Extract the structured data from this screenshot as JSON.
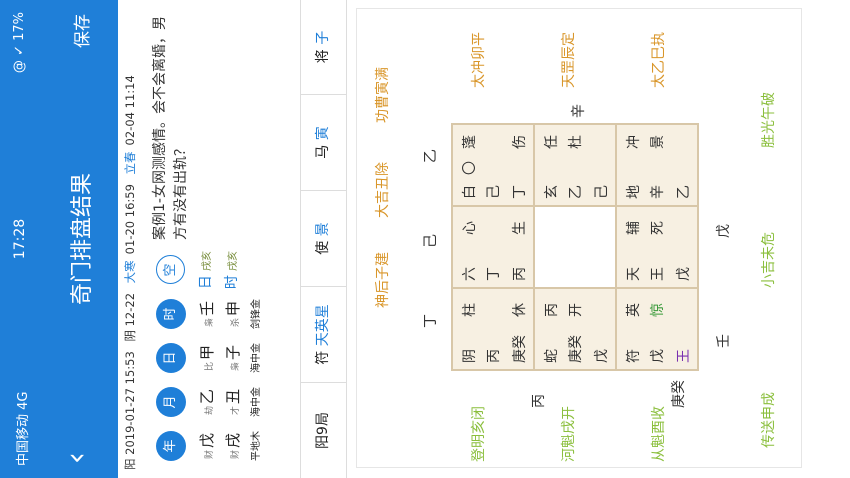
{
  "status": {
    "carrier": "中国移动 4G",
    "time": "17:28",
    "battery": "@ ✓ 17%"
  },
  "header": {
    "title": "奇门排盘结果",
    "save": "保存"
  },
  "dates": {
    "solar": "阳 2019-01-27 15:53",
    "lunar": "阴 12-22",
    "jieqi1": "大寒",
    "jieqi1_time": "01-20 16:59",
    "jieqi2": "立春",
    "jieqi2_time": "02-04 11:14"
  },
  "pillars": [
    {
      "label": "年",
      "tg_rel": "财",
      "tg": "戊",
      "dz_rel": "财",
      "dz": "戌",
      "nayin": "平地木"
    },
    {
      "label": "月",
      "tg_rel": "劫",
      "tg": "乙",
      "dz_rel": "才",
      "dz": "丑",
      "nayin": "海中金"
    },
    {
      "label": "日",
      "tg_rel": "比",
      "tg": "甲",
      "dz_rel": "枭",
      "dz": "子",
      "nayin": "海中金"
    },
    {
      "label": "时",
      "tg_rel": "枭",
      "tg": "壬",
      "dz_rel": "杀",
      "dz": "申",
      "nayin": "剑锋金"
    },
    {
      "label": "空",
      "tg_rel": "",
      "tg": "日",
      "dz_rel": "",
      "dz": "时",
      "tg_extra": "戌亥",
      "dz_extra": "戌亥",
      "nayin": ""
    }
  ],
  "question": "案例1-女网测感情。会不会离婚，男方有没有出轨？",
  "bottombar": [
    {
      "a": "阳9局",
      "b": ""
    },
    {
      "a": "符",
      "b": "天英星"
    },
    {
      "a": "使",
      "b": "景"
    },
    {
      "a": "马",
      "b": "寅"
    },
    {
      "a": "将",
      "b": "子"
    }
  ],
  "palaces": [
    {
      "cells": [
        "阴",
        "丙",
        "柱",
        "庚癸",
        "休"
      ]
    },
    {
      "cells": [
        "六",
        "丁",
        "心",
        "丙",
        "生"
      ]
    },
    {
      "cells": [
        "白",
        "〇",
        "蓬",
        "己",
        "丁",
        "伤"
      ]
    },
    {
      "cells": [
        "蛇",
        "丙",
        "庚癸",
        "开",
        "戊"
      ]
    },
    {
      "cells": [
        "玄",
        "任",
        "乙",
        "杜",
        "己"
      ]
    },
    {
      "cells": [
        "符",
        "英",
        "戊",
        "惊",
        "王"
      ]
    },
    {
      "cells": [
        "天",
        "辅",
        "王",
        "死",
        "戊"
      ]
    },
    {
      "cells": [
        "地",
        "冲",
        "辛",
        "景",
        "乙"
      ]
    }
  ],
  "outside": {
    "top_left_spirit": "神后子建",
    "top_mid_spirit": "大吉丑除",
    "top_right_spirit": "功曹寅满",
    "left_top": "登明亥闭",
    "left_mid": "河魁戌开",
    "left_bot": "从魁酉收",
    "right_top": "太冲卯平",
    "right_mid": "天罡辰定",
    "right_bot": "太乙巳执",
    "bot_left": "传送申成",
    "bot_mid": "小吉未危",
    "bot_right": "胜光午破",
    "stem_top_left": "丁",
    "stem_top_mid": "己",
    "stem_top_right": "乙",
    "stem_left_top": "丙",
    "stem_left_bot": "庚癸",
    "stem_right": "辛",
    "stem_bot_left": "壬",
    "stem_bot_mid": "戊"
  },
  "colors": {
    "blue": "#1f7fd8",
    "palace": "#f7f0e2",
    "green": "#8bbf3d",
    "orange": "#d9962a"
  }
}
